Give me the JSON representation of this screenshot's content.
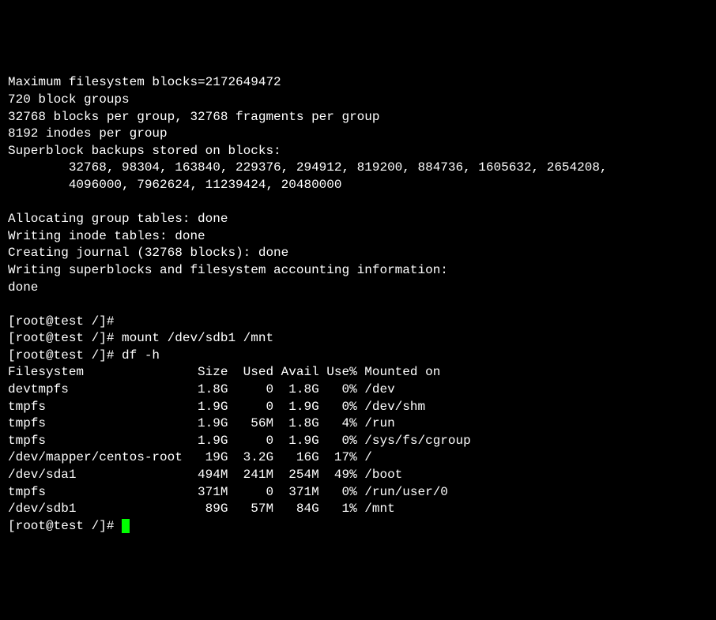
{
  "output_lines": {
    "l0": "Maximum filesystem blocks=2172649472",
    "l1": "720 block groups",
    "l2": "32768 blocks per group, 32768 fragments per group",
    "l3": "8192 inodes per group",
    "l4": "Superblock backups stored on blocks:",
    "l5": "        32768, 98304, 163840, 229376, 294912, 819200, 884736, 1605632, 2654208,",
    "l6": "        4096000, 7962624, 11239424, 20480000",
    "l7": "",
    "l8": "Allocating group tables: done",
    "l9": "Writing inode tables: done",
    "l10": "Creating journal (32768 blocks): done",
    "l11": "Writing superblocks and filesystem accounting information:",
    "l12": "done",
    "l13": ""
  },
  "prompts": {
    "p1": "[root@test /]#",
    "p2": "[root@test /]# mount /dev/sdb1 /mnt",
    "p3": "[root@test /]# df -h",
    "p4": "[root@test /]# "
  },
  "df_header": "Filesystem               Size  Used Avail Use% Mounted on",
  "df_rows": {
    "r0": "devtmpfs                 1.8G     0  1.8G   0% /dev",
    "r1": "tmpfs                    1.9G     0  1.9G   0% /dev/shm",
    "r2": "tmpfs                    1.9G   56M  1.8G   4% /run",
    "r3": "tmpfs                    1.9G     0  1.9G   0% /sys/fs/cgroup",
    "r4": "/dev/mapper/centos-root   19G  3.2G   16G  17% /",
    "r5": "/dev/sda1                494M  241M  254M  49% /boot",
    "r6": "tmpfs                    371M     0  371M   0% /run/user/0",
    "r7": "/dev/sdb1                 89G   57M   84G   1% /mnt"
  },
  "chart_data": {
    "type": "table",
    "title": "df -h output",
    "columns": [
      "Filesystem",
      "Size",
      "Used",
      "Avail",
      "Use%",
      "Mounted on"
    ],
    "rows": [
      [
        "devtmpfs",
        "1.8G",
        "0",
        "1.8G",
        "0%",
        "/dev"
      ],
      [
        "tmpfs",
        "1.9G",
        "0",
        "1.9G",
        "0%",
        "/dev/shm"
      ],
      [
        "tmpfs",
        "1.9G",
        "56M",
        "1.8G",
        "4%",
        "/run"
      ],
      [
        "tmpfs",
        "1.9G",
        "0",
        "1.9G",
        "0%",
        "/sys/fs/cgroup"
      ],
      [
        "/dev/mapper/centos-root",
        "19G",
        "3.2G",
        "16G",
        "17%",
        "/"
      ],
      [
        "/dev/sda1",
        "494M",
        "241M",
        "254M",
        "49%",
        "/boot"
      ],
      [
        "tmpfs",
        "371M",
        "0",
        "371M",
        "0%",
        "/run/user/0"
      ],
      [
        "/dev/sdb1",
        "89G",
        "57M",
        "84G",
        "1%",
        "/mnt"
      ]
    ]
  }
}
